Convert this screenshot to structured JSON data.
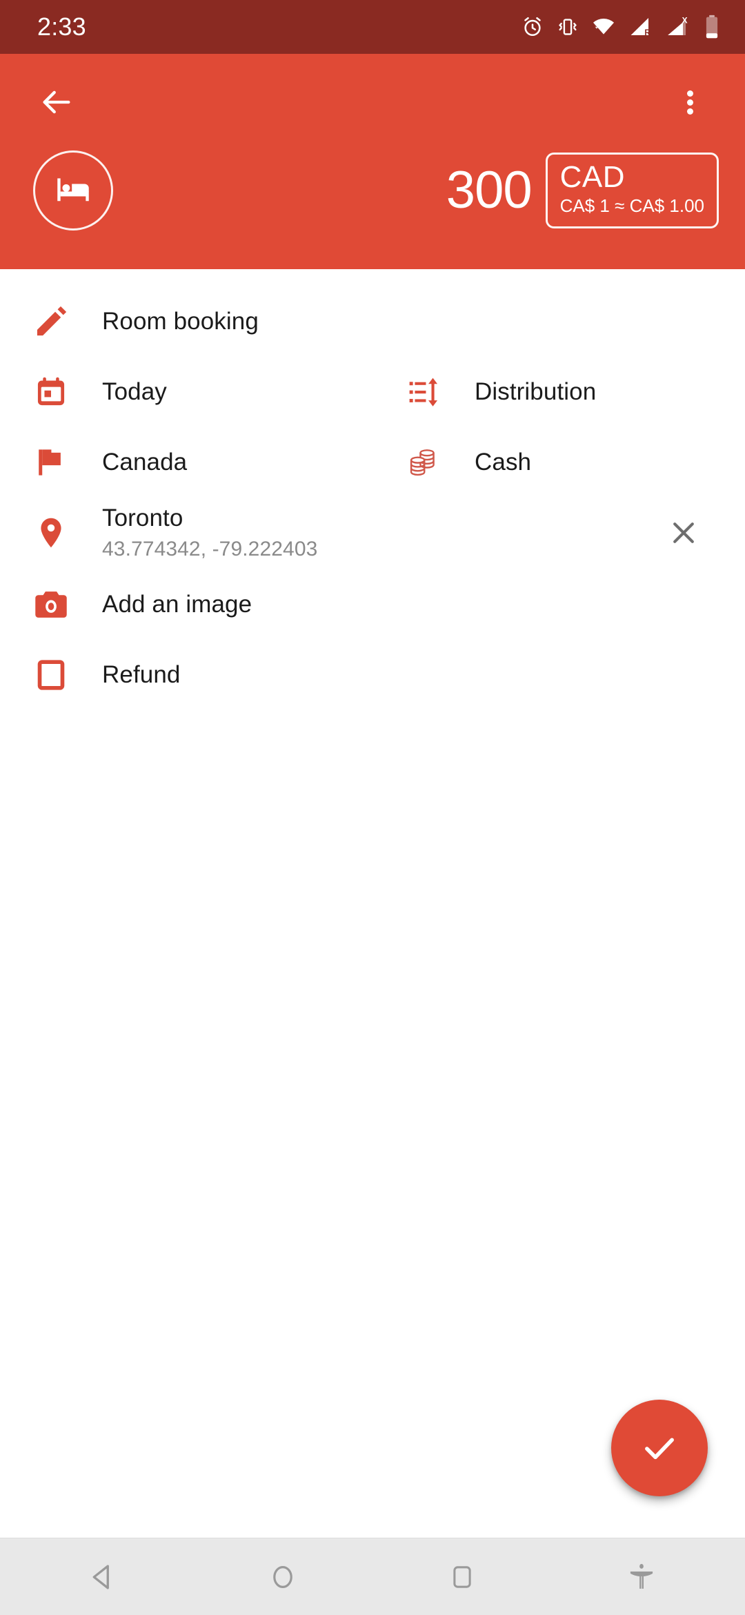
{
  "status_bar": {
    "clock": "2:33",
    "icons": [
      "alarm-icon",
      "vibrate-icon",
      "wifi-icon",
      "signal-roaming-icon",
      "signal-no-sim-icon",
      "battery-icon"
    ],
    "background_color": "#8A2A22"
  },
  "app_bar": {
    "back_label": "Back",
    "overflow_label": "More options",
    "background_color": "#E04A36"
  },
  "header": {
    "category_icon": "bed-icon",
    "amount": "300",
    "currency_code": "CAD",
    "currency_rate": "CA$ 1 ≈ CA$ 1.00"
  },
  "form": {
    "rows": [
      {
        "name": "description",
        "icon": "pencil-icon",
        "label": "Room booking"
      },
      {
        "name": "date",
        "icon": "calendar-icon",
        "label": "Today"
      },
      {
        "name": "distribution",
        "icon": "distribution-icon",
        "label": "Distribution"
      },
      {
        "name": "country",
        "icon": "flag-icon",
        "label": "Canada"
      },
      {
        "name": "payment-method",
        "icon": "coins-icon",
        "label": "Cash"
      },
      {
        "name": "location",
        "icon": "location-pin-icon",
        "label": "Toronto",
        "sub": "43.774342, -79.222403",
        "clear_icon": "close-icon"
      },
      {
        "name": "add-image",
        "icon": "camera-icon",
        "label": "Add an image"
      },
      {
        "name": "refund",
        "icon": "checkbox-unchecked-icon",
        "label": "Refund",
        "checked": false
      }
    ]
  },
  "fab": {
    "icon": "check-icon",
    "label": "Save",
    "color": "#E04A36"
  },
  "nav_bar": {
    "buttons": [
      {
        "name": "back",
        "icon": "triangle-back-icon"
      },
      {
        "name": "home",
        "icon": "circle-home-icon"
      },
      {
        "name": "recents",
        "icon": "square-recents-icon"
      },
      {
        "name": "accessibility",
        "icon": "accessibility-icon"
      }
    ],
    "background_color": "#E8E8E8"
  },
  "colors": {
    "accent": "#E04A36",
    "status_bar": "#8A2A22",
    "text_primary": "#1b1b1b",
    "text_secondary": "#8a8a8a"
  }
}
